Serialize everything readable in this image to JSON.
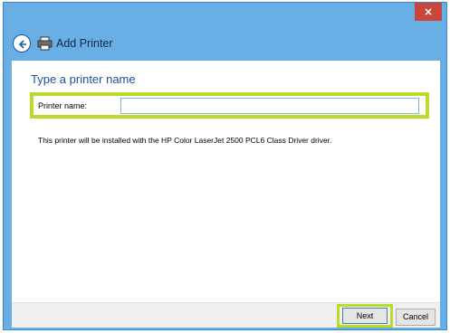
{
  "window": {
    "close_glyph": "×",
    "colors": {
      "frame": "#6aaee6",
      "close_button": "#c9463d",
      "highlight": "#b7dc2a",
      "section_title": "#1f4f96"
    }
  },
  "header": {
    "title": "Add Printer",
    "back_icon": "back-arrow-icon",
    "printer_icon": "printer-icon"
  },
  "main": {
    "section_title": "Type a printer name",
    "printer_name": {
      "label": "Printer name:",
      "value": ""
    },
    "info_text": "This printer will be installed with the HP Color LaserJet 2500 PCL6 Class Driver driver."
  },
  "footer": {
    "next_label": "Next",
    "cancel_label": "Cancel"
  }
}
